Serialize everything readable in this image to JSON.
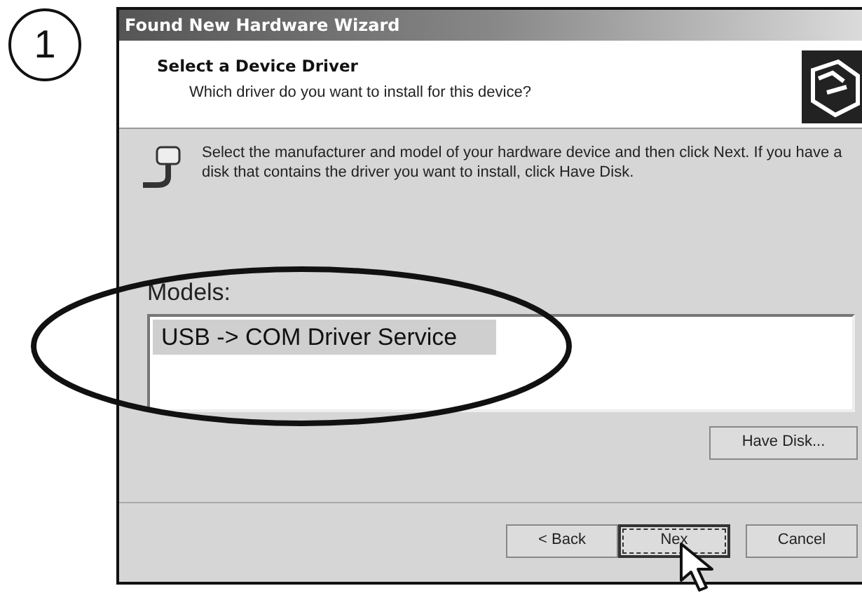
{
  "step": "1",
  "window": {
    "title": "Found New Hardware Wizard"
  },
  "header": {
    "title": "Select a Device Driver",
    "subtitle": "Which driver do you want to install for this device?"
  },
  "instructions": "Select the manufacturer and model of your hardware device and then click Next. If you have a disk that contains the driver you want to install, click Have Disk.",
  "models": {
    "label": "Models:",
    "items": [
      {
        "label": "USB -> COM Driver Service",
        "selected": true
      }
    ]
  },
  "have_disk_button": "Have Disk...",
  "buttons": [
    {
      "label": "< Back",
      "focused": false
    },
    {
      "label": "Nex",
      "focused": true
    },
    {
      "label": "Cancel",
      "focused": false
    }
  ]
}
